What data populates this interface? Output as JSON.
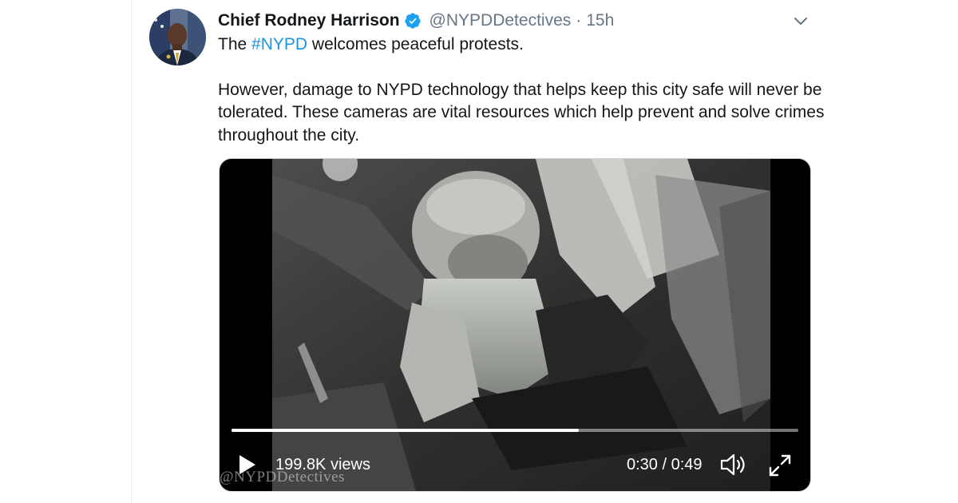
{
  "tweet": {
    "author_name": "Chief Rodney Harrison",
    "handle": "@NYPDDetectives",
    "separator": "·",
    "time": "15h",
    "verified": true,
    "text": {
      "line1_prefix": "The ",
      "hashtag": "#NYPD",
      "line1_suffix": " welcomes peaceful protests.",
      "paragraph2": "However, damage to NYPD technology that helps keep this city safe will never be tolerated. These cameras are vital resources which help prevent and solve crimes throughout the city."
    }
  },
  "video": {
    "views": "199.8K views",
    "timecode": "0:30 / 0:49",
    "progress_fraction": 0.612,
    "watermark": "@NYPDDetectives"
  },
  "icons": {
    "verified": "verified-badge-icon",
    "menu": "chevron-down-icon",
    "play": "play-icon",
    "volume": "volume-icon",
    "expand": "expand-icon"
  },
  "colors": {
    "link": "#1b95e0",
    "verified": "#1da1f2",
    "secondary_text": "#657786",
    "primary_text": "#14171a"
  }
}
